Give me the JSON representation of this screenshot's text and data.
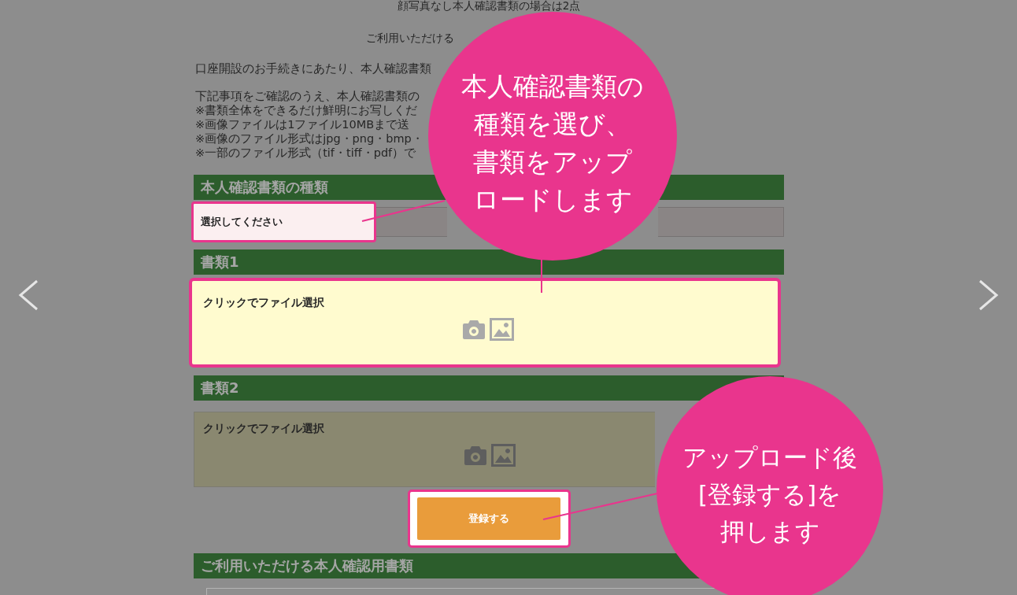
{
  "notice": "顔写真なし本人確認書類の場合は2点",
  "subnotice": "ご利用いただける",
  "intro": "口座開設のお手続きにあたり、本人確認書類",
  "instructions": [
    "下記事項をご確認のうえ、本人確認書類の",
    "※書類全体をできるだけ鮮明にお写しくだ",
    "※画像ファイルは1ファイル10MBまで送",
    "※画像のファイル形式はjpg・png・bmp・",
    "※一部のファイル形式（tif・tiff・pdf）で"
  ],
  "sections": [
    {
      "kind": "select",
      "title": "本人確認書類の種類",
      "placeholder": "選択してください",
      "highlighted": true
    },
    {
      "kind": "upload",
      "title": "書類1",
      "prompt": "クリックでファイル選択",
      "highlighted": true
    },
    {
      "kind": "upload",
      "title": "書類2",
      "prompt": "クリックでファイル選択",
      "highlighted": false
    }
  ],
  "submit_button": {
    "label": "登録する",
    "highlighted": true
  },
  "bottom_section": {
    "title": "ご利用いただける本人確認用書類"
  },
  "callouts": [
    {
      "lines": [
        "本人確認書類の",
        "種類を選び、",
        "書類をアップ",
        "ロードします"
      ]
    },
    {
      "lines": [
        "アップロード後",
        "[登録する]を",
        "押します"
      ]
    }
  ]
}
